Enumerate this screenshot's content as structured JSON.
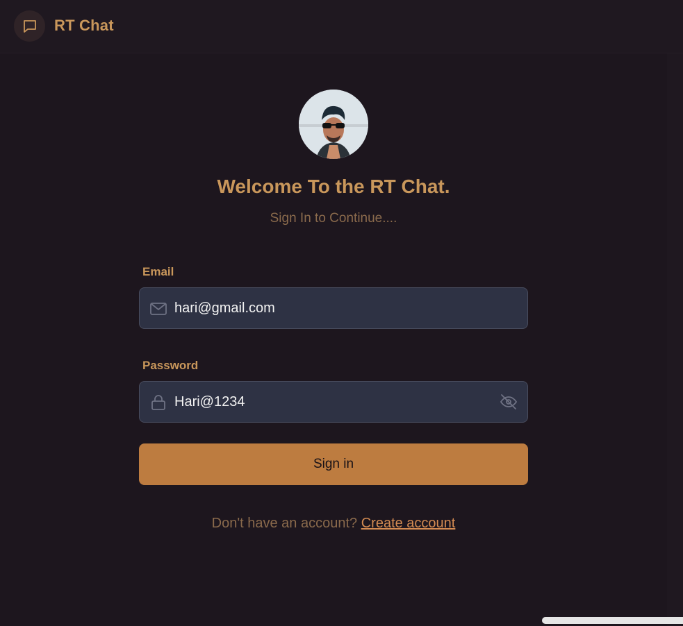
{
  "header": {
    "logo_icon": "chat-bubble-icon",
    "title": "RT Chat"
  },
  "login": {
    "avatar_icon": "user-avatar",
    "welcome": "Welcome To the RT Chat.",
    "subtitle": "Sign In to Continue....",
    "email": {
      "label": "Email",
      "value": "hari@gmail.com",
      "icon": "mail-icon"
    },
    "password": {
      "label": "Password",
      "value": "Hari@1234",
      "icon": "lock-icon",
      "toggle_icon": "eye-off-icon"
    },
    "signin_label": "Sign in",
    "footer_text": "Don't have an account?",
    "create_account_label": "Create account"
  },
  "colors": {
    "background": "#1d161e",
    "accent": "#c9975b",
    "button": "#bd7c40",
    "input_bg": "#2e3244",
    "link": "#d48b52"
  }
}
